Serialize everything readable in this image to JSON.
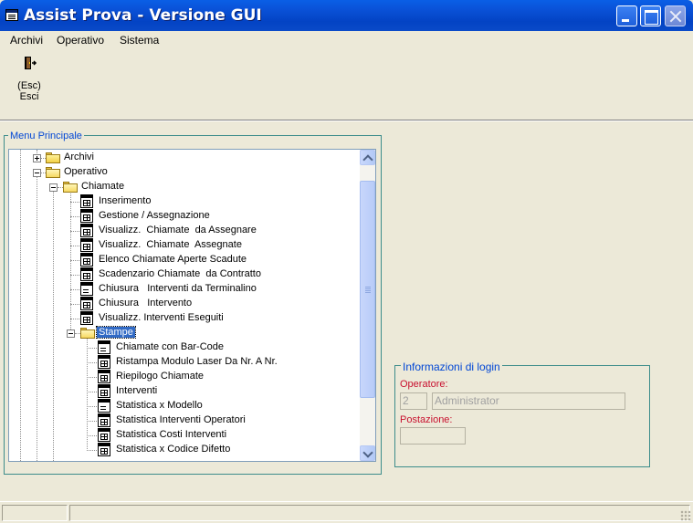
{
  "window": {
    "title": "Assist Prova - Versione GUI",
    "icon": "window-form-icon"
  },
  "menubar": {
    "items": [
      "Archivi",
      "Operativo",
      "Sistema"
    ]
  },
  "toolbar": {
    "exit": {
      "icon": "exit-door-icon",
      "shortcut": "(Esc)",
      "label": "Esci"
    }
  },
  "menu_principale": {
    "title": "Menu Principale",
    "tree": {
      "archivi": "Archivi",
      "operativo": "Operativo",
      "chiamate": "Chiamate",
      "chiamate_items": [
        "Inserimento",
        "Gestione / Assegnazione",
        "Visualizz.  Chiamate  da Assegnare",
        "Visualizz.  Chiamate  Assegnate",
        "Elenco Chiamate Aperte Scadute",
        "Scadenzario Chiamate  da Contratto",
        "Chiusura   Interventi da Terminalino",
        "Chiusura   Intervento",
        "Visualizz. Interventi Eseguiti"
      ],
      "stampe": "Stampe",
      "stampe_items": [
        "Chiamate con Bar-Code",
        "Ristampa Modulo Laser Da Nr. A Nr.",
        "Riepilogo Chiamate",
        "Interventi",
        "Statistica x Modello",
        "Statistica Interventi Operatori",
        "Statistica Costi Interventi",
        "Statistica x Codice Difetto"
      ]
    }
  },
  "login": {
    "title": "Informazioni di login",
    "operatore_label": "Operatore:",
    "operatore_code": "2",
    "operatore_name": "Administrator",
    "postazione_label": "Postazione:",
    "postazione_value": ""
  },
  "colors": {
    "titlebar": "#0A52D8",
    "groupbox_border": "#3D8D8B",
    "groupbox_title": "#0046D5",
    "login_labels": "#C8102E",
    "selection": "#316AC5"
  }
}
